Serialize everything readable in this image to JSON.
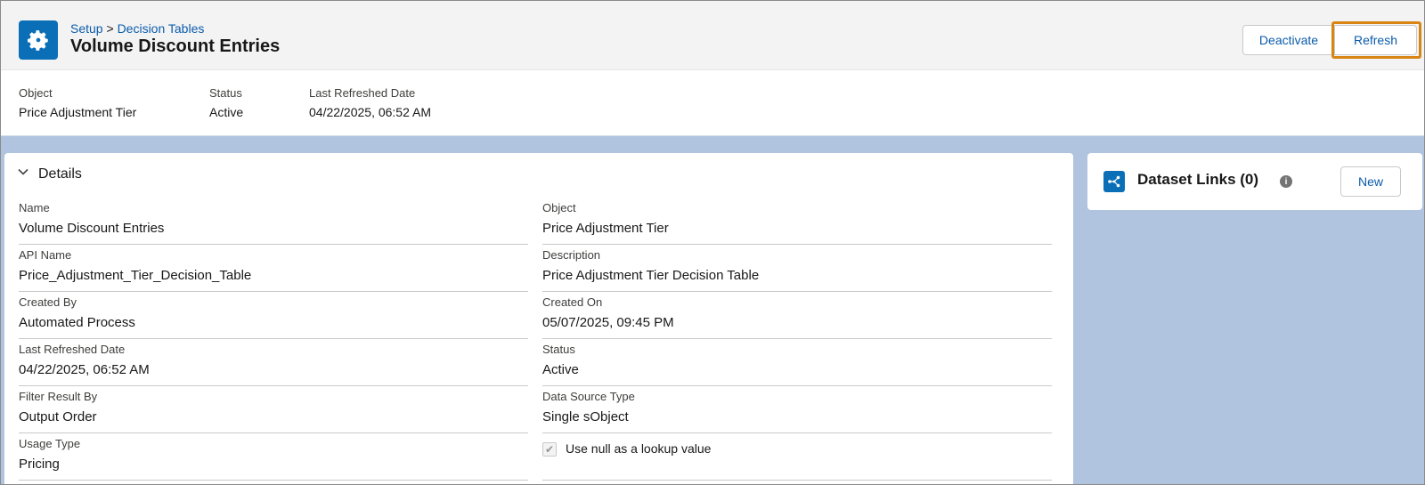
{
  "breadcrumb": {
    "setup": "Setup",
    "separator": " > ",
    "current": "Decision Tables"
  },
  "page": {
    "title": "Volume Discount Entries",
    "icon": "gear-icon"
  },
  "actions": {
    "deactivate": "Deactivate",
    "refresh": "Refresh"
  },
  "highlights": [
    {
      "label": "Object",
      "value": "Price Adjustment Tier"
    },
    {
      "label": "Status",
      "value": "Active"
    },
    {
      "label": "Last Refreshed Date",
      "value": "04/22/2025, 06:52 AM"
    }
  ],
  "details": {
    "section_title": "Details",
    "left": [
      {
        "label": "Name",
        "value": "Volume Discount Entries"
      },
      {
        "label": "API Name",
        "value": "Price_Adjustment_Tier_Decision_Table"
      },
      {
        "label": "Created By",
        "value": "Automated Process"
      },
      {
        "label": "Last Refreshed Date",
        "value": "04/22/2025, 06:52 AM"
      },
      {
        "label": "Filter Result By",
        "value": "Output Order"
      },
      {
        "label": "Usage Type",
        "value": "Pricing"
      }
    ],
    "right": [
      {
        "label": "Object",
        "value": "Price Adjustment Tier"
      },
      {
        "label": "Description",
        "value": "Price Adjustment Tier Decision Table"
      },
      {
        "label": "Created On",
        "value": "05/07/2025, 09:45 PM"
      },
      {
        "label": "Status",
        "value": "Active"
      },
      {
        "label": "Data Source Type",
        "value": "Single sObject"
      }
    ],
    "null_lookup": {
      "label": "Use null as a lookup value",
      "checked": true
    }
  },
  "dataset_links": {
    "title": "Dataset Links (0)",
    "new_label": "New",
    "icon": "dataset-link-icon"
  },
  "colors": {
    "brand": "#0b6fb8",
    "link": "#0b5cab",
    "highlight_border": "#d98514",
    "background": "#b0c4df"
  }
}
